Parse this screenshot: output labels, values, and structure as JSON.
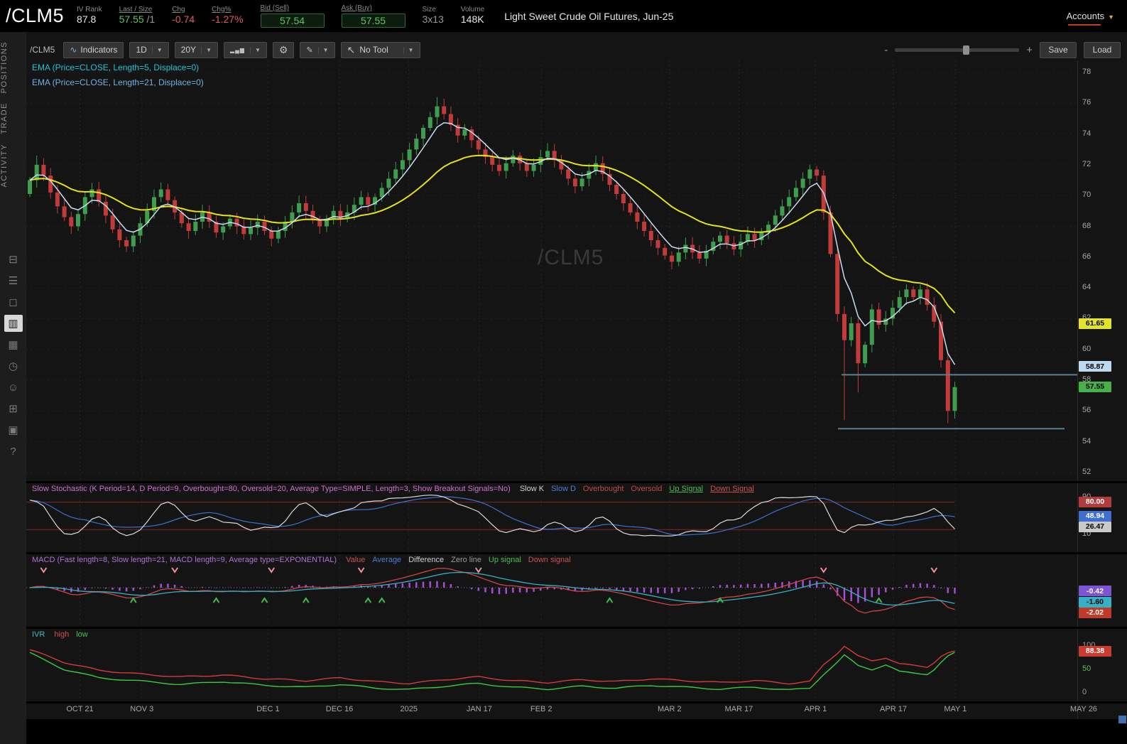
{
  "header": {
    "symbol": "/CLM5",
    "stats": [
      {
        "label": "IV Rank",
        "value": "87.8"
      },
      {
        "label": "Last / Size",
        "value": "57.55",
        "suffix": " /1"
      },
      {
        "label": "Chg",
        "value": "-0.74"
      },
      {
        "label": "Chg%",
        "value": "-1.27%"
      },
      {
        "label": "Bid (Sell)",
        "value": "57.54"
      },
      {
        "label": "Ask (Buy)",
        "value": "57.55"
      },
      {
        "label": "Size",
        "value": "3x13"
      },
      {
        "label": "Volume",
        "value": "148K"
      }
    ],
    "description": "Light Sweet Crude Oil Futures, Jun-25",
    "accounts_label": "Accounts"
  },
  "sidebar": {
    "tabs": [
      "POSITIONS",
      "TRADE",
      "ACTIVITY"
    ],
    "icons": [
      {
        "name": "monitor-icon",
        "glyph": "⊟",
        "active": false
      },
      {
        "name": "watchlist-icon",
        "glyph": "☰",
        "active": false
      },
      {
        "name": "tv-icon",
        "glyph": "◻",
        "active": false
      },
      {
        "name": "charts-icon",
        "glyph": "▥",
        "active": true
      },
      {
        "name": "grid-icon",
        "glyph": "▦",
        "active": false
      },
      {
        "name": "history-clock-icon",
        "glyph": "◷",
        "active": false
      },
      {
        "name": "people-icon",
        "glyph": "☺",
        "active": false
      },
      {
        "name": "products-box-icon",
        "glyph": "⊞",
        "active": false
      },
      {
        "name": "calendar-icon",
        "glyph": "▣",
        "active": false
      },
      {
        "name": "help-icon",
        "glyph": "?",
        "active": false
      }
    ]
  },
  "toolbar": {
    "symbol_label": "/CLM5",
    "indicators_label": "Indicators",
    "timeframe": "1D",
    "range": "20Y",
    "tool_label": "No Tool",
    "save_label": "Save",
    "load_label": "Load",
    "zoom_minus": "-",
    "zoom_plus": "+"
  },
  "watermark": "/CLM5",
  "legend": {
    "items": [
      {
        "label": "EMA (Price=CLOSE, Length=5, Displace=0)",
        "color": "#1fc4d6"
      },
      {
        "label": "EMA (Price=CLOSE, Length=21, Displace=0)",
        "color": "#6fb3e0"
      }
    ]
  },
  "panels": {
    "stochastic": {
      "title": "Slow Stochastic (K Period=14, D Period=9, Overbought=80, Oversold=20, Average Type=SIMPLE, Length=3, Show Breakout Signals=No)",
      "title_color": "#cf6fcf",
      "items": [
        {
          "label": "Slow K",
          "color": "#cfcfcf"
        },
        {
          "label": "Slow D",
          "color": "#4a7dd6"
        },
        {
          "label": "Overbought",
          "color": "#c24848"
        },
        {
          "label": "Oversold",
          "color": "#c24848"
        },
        {
          "label": "Up Signal",
          "color": "#46c24a",
          "underline": true
        },
        {
          "label": "Down Signal",
          "color": "#d05050",
          "underline": true
        }
      ]
    },
    "macd": {
      "title": "MACD (Fast length=8, Slow length=21, MACD length=9, Average type=EXPONENTIAL)",
      "title_color": "#b070d8",
      "items": [
        {
          "label": "Value",
          "color": "#d05050"
        },
        {
          "label": "Average",
          "color": "#4a7dd6"
        },
        {
          "label": "Difference",
          "color": "#cfcfcf"
        },
        {
          "label": "Zero line",
          "color": "#9a9a9a"
        },
        {
          "label": "Up signal",
          "color": "#46c24a"
        },
        {
          "label": "Down signal",
          "color": "#d05050"
        }
      ]
    },
    "ivr": {
      "title": "IVR",
      "title_color": "#3bbfbf",
      "items": [
        {
          "label": "high",
          "color": "#d05050"
        },
        {
          "label": "low",
          "color": "#46c24a"
        }
      ]
    }
  },
  "chart_data": {
    "type": "candlestick",
    "symbol": "/CLM5",
    "timeframe": "1D",
    "range": "20Y",
    "price_axis": {
      "min": 51.4,
      "max": 78.8,
      "ticks": [
        78,
        76,
        74,
        72,
        70,
        68,
        66,
        64,
        62,
        60,
        58,
        56,
        54,
        52
      ]
    },
    "x_axis": {
      "ticks": [
        {
          "label": "OCT 21",
          "frac": 0.051
        },
        {
          "label": "NOV 3",
          "frac": 0.11
        },
        {
          "label": "DEC 1",
          "frac": 0.23
        },
        {
          "label": "DEC 16",
          "frac": 0.298
        },
        {
          "label": "2025",
          "frac": 0.364
        },
        {
          "label": "JAN 17",
          "frac": 0.431
        },
        {
          "label": "FEB 2",
          "frac": 0.49
        },
        {
          "label": "MAR 2",
          "frac": 0.612
        },
        {
          "label": "MAR 17",
          "frac": 0.678
        },
        {
          "label": "APR 1",
          "frac": 0.751
        },
        {
          "label": "APR 17",
          "frac": 0.825
        },
        {
          "label": "MAY 1",
          "frac": 0.884
        },
        {
          "label": "MAY 26",
          "frac": 1.006
        }
      ]
    },
    "closes": [
      71.0,
      72.0,
      71.3,
      70.2,
      69.3,
      68.6,
      68.0,
      68.8,
      69.9,
      70.4,
      69.6,
      68.7,
      67.8,
      67.1,
      66.7,
      67.4,
      68.2,
      69.0,
      69.9,
      70.4,
      69.7,
      68.9,
      68.2,
      67.7,
      68.3,
      68.9,
      68.3,
      67.6,
      68.0,
      68.5,
      68.0,
      67.5,
      67.9,
      68.3,
      67.7,
      67.2,
      67.7,
      68.3,
      68.9,
      69.5,
      69.0,
      68.4,
      68.0,
      68.5,
      69.0,
      68.5,
      68.9,
      69.4,
      69.9,
      69.4,
      69.9,
      70.5,
      71.1,
      71.7,
      72.3,
      73.0,
      73.7,
      74.4,
      75.1,
      75.8,
      75.3,
      74.6,
      73.9,
      74.3,
      73.6,
      73.0,
      72.5,
      72.0,
      71.6,
      72.1,
      72.6,
      72.1,
      71.6,
      72.0,
      72.5,
      72.9,
      72.3,
      71.7,
      71.1,
      70.6,
      71.1,
      71.6,
      72.1,
      71.4,
      70.7,
      70.1,
      69.5,
      68.9,
      68.3,
      67.7,
      67.1,
      66.6,
      66.1,
      65.7,
      66.3,
      66.8,
      66.3,
      65.9,
      66.4,
      67.0,
      67.4,
      66.9,
      66.5,
      67.0,
      67.5,
      67.1,
      67.6,
      68.1,
      68.7,
      69.3,
      69.9,
      70.5,
      71.1,
      71.7,
      71.3,
      68.9,
      66.2,
      62.3,
      60.6,
      61.7,
      59.1,
      60.3,
      62.6,
      61.6,
      62.0,
      62.7,
      63.4,
      63.9,
      63.4,
      63.9,
      62.9,
      61.8,
      59.3,
      56.0,
      57.55
    ],
    "high_overrides": {
      "1": 72.6,
      "59": 76.4
    },
    "low_overrides": {
      "118": 55.4,
      "120": 57.2,
      "133": 55.2
    },
    "emas": [
      {
        "length": 5
      },
      {
        "length": 21
      }
    ],
    "support_lines": [
      {
        "price": 58.35,
        "from_frac": 0.776,
        "to_frac": 1.0
      },
      {
        "price": 54.85,
        "from_frac": 0.772,
        "to_frac": 0.988
      }
    ],
    "badges": [
      {
        "text": "61.65",
        "price": 61.65,
        "bg": "#e3e32a",
        "fg": "#000"
      },
      {
        "text": "58.87",
        "price": 58.87,
        "bg": "#bcd9ef",
        "fg": "#000"
      },
      {
        "text": "57.55",
        "price": 57.55,
        "bg": "#47b04b",
        "fg": "#000"
      }
    ],
    "stochastic": {
      "k_period": 14,
      "d_period": 9,
      "overbought": 80,
      "oversold": 20,
      "ticks": [
        {
          "label": "90",
          "value": 90
        },
        {
          "label": "10",
          "value": 10
        }
      ],
      "badges": [
        {
          "text": "80.00",
          "value": 80,
          "bg": "#b23b3b",
          "fg": "#fff"
        },
        {
          "text": "48.94",
          "value": 48.94,
          "bg": "#3f6fd0",
          "fg": "#fff"
        },
        {
          "text": "26.47",
          "value": 26.47,
          "bg": "#c9c9c9",
          "fg": "#000"
        }
      ]
    },
    "macd": {
      "fast": 8,
      "slow": 21,
      "signal": 9,
      "up_signals": [
        15,
        27,
        34,
        40,
        49,
        51,
        84,
        100,
        123
      ],
      "down_signals": [
        2,
        21,
        35,
        48,
        65,
        115,
        131
      ],
      "badges": [
        {
          "text": "-0.42",
          "value": -0.42,
          "bg": "#7d55d4",
          "fg": "#fff"
        },
        {
          "text": "-1.60",
          "value": -1.6,
          "bg": "#35b0c5",
          "fg": "#000"
        },
        {
          "text": "-2.02",
          "value": -2.02,
          "bg": "#c0392b",
          "fg": "#fff"
        }
      ]
    },
    "ivr": {
      "ticks": [
        {
          "label": "100",
          "value": 100,
          "color": "#9a9a9a"
        },
        {
          "label": "50",
          "value": 50,
          "color": "#58c258"
        },
        {
          "label": "0",
          "value": 0,
          "color": "#9a9a9a"
        }
      ],
      "badge": {
        "text": "88.38",
        "value": 88.38,
        "bg": "#cc3b2f",
        "fg": "#fff"
      },
      "red_keyframes": [
        [
          0,
          92
        ],
        [
          5,
          65
        ],
        [
          10,
          48
        ],
        [
          16,
          40
        ],
        [
          22,
          34
        ],
        [
          28,
          38
        ],
        [
          34,
          30
        ],
        [
          40,
          26
        ],
        [
          45,
          32
        ],
        [
          50,
          24
        ],
        [
          55,
          20
        ],
        [
          60,
          28
        ],
        [
          65,
          34
        ],
        [
          70,
          26
        ],
        [
          75,
          22
        ],
        [
          80,
          28
        ],
        [
          85,
          24
        ],
        [
          90,
          30
        ],
        [
          95,
          26
        ],
        [
          100,
          22
        ],
        [
          105,
          26
        ],
        [
          110,
          20
        ],
        [
          113,
          24
        ],
        [
          115,
          60
        ],
        [
          117,
          85
        ],
        [
          118,
          100
        ],
        [
          120,
          78
        ],
        [
          122,
          68
        ],
        [
          124,
          75
        ],
        [
          126,
          62
        ],
        [
          128,
          58
        ],
        [
          130,
          55
        ],
        [
          131,
          65
        ],
        [
          132,
          78
        ],
        [
          133,
          85
        ],
        [
          134,
          88
        ]
      ],
      "green_keyframes": [
        [
          0,
          85
        ],
        [
          5,
          50
        ],
        [
          10,
          32
        ],
        [
          16,
          25
        ],
        [
          22,
          18
        ],
        [
          28,
          24
        ],
        [
          34,
          16
        ],
        [
          40,
          12
        ],
        [
          45,
          18
        ],
        [
          50,
          10
        ],
        [
          55,
          7
        ],
        [
          60,
          14
        ],
        [
          65,
          20
        ],
        [
          70,
          12
        ],
        [
          75,
          8
        ],
        [
          80,
          14
        ],
        [
          85,
          10
        ],
        [
          90,
          16
        ],
        [
          95,
          12
        ],
        [
          100,
          8
        ],
        [
          105,
          12
        ],
        [
          110,
          6
        ],
        [
          113,
          10
        ],
        [
          115,
          40
        ],
        [
          117,
          65
        ],
        [
          118,
          80
        ],
        [
          120,
          58
        ],
        [
          122,
          50
        ],
        [
          124,
          60
        ],
        [
          126,
          45
        ],
        [
          128,
          42
        ],
        [
          130,
          40
        ],
        [
          131,
          50
        ],
        [
          132,
          65
        ],
        [
          133,
          78
        ],
        [
          134,
          85
        ]
      ]
    },
    "colors": {
      "up": "#3f9e4d",
      "down": "#c23b3b",
      "ema5": "#c9ddf0",
      "ema21": "#e3e319",
      "slow_k": "#d9d9d9",
      "slow_d": "#3f6fd0",
      "ob_os": "#7e2727",
      "macd_value": "#d04545",
      "macd_avg": "#35b0c5",
      "macd_hist": "#a64dd6",
      "up_arrow": "#3ec24d",
      "down_arrow": "#f2909e",
      "ivr_high": "#d23b3b",
      "ivr_low": "#3dc93d",
      "support": "#5b7f94",
      "grid": "#262626"
    }
  }
}
